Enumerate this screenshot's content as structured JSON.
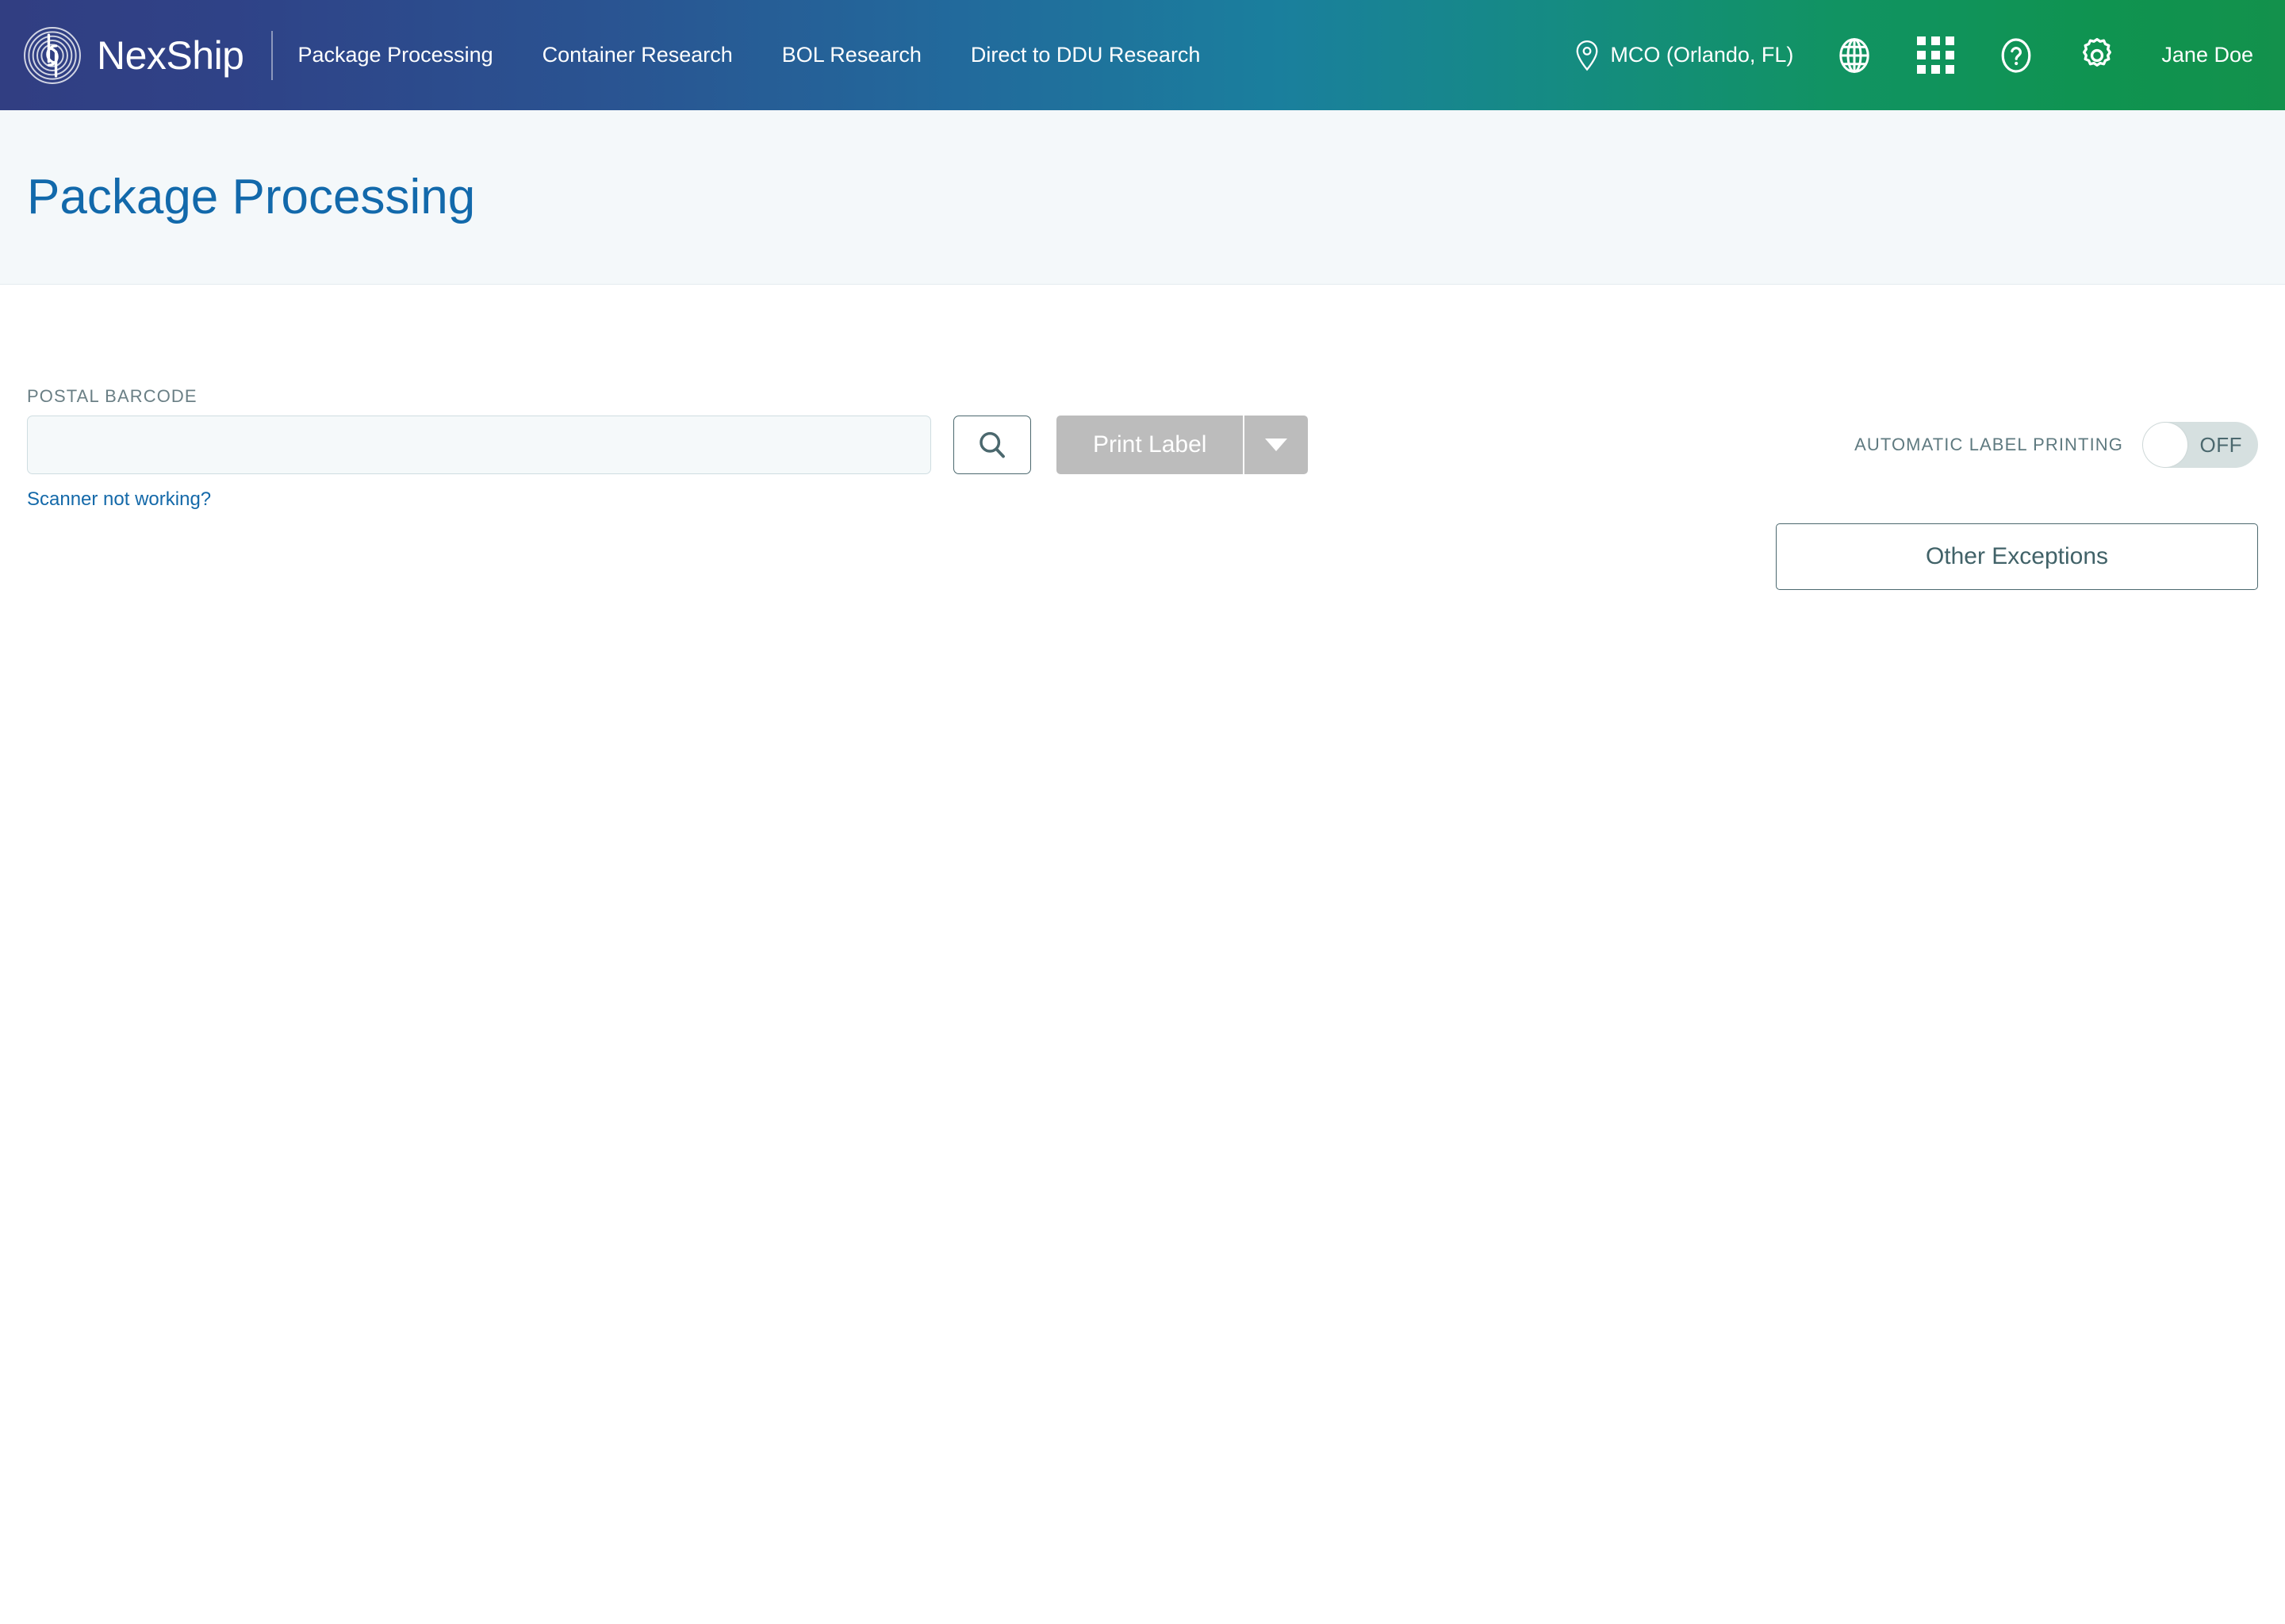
{
  "header": {
    "brand_name": "NexShip",
    "logo_icon": "nexship-fingerprint-logo",
    "nav": [
      {
        "label": "Package Processing",
        "icon": ""
      },
      {
        "label": "Container Research",
        "icon": ""
      },
      {
        "label": "BOL Research",
        "icon": ""
      },
      {
        "label": "Direct to DDU Research",
        "icon": ""
      }
    ],
    "location": {
      "icon": "location-pin-icon",
      "label": "MCO (Orlando, FL)"
    },
    "icons": [
      {
        "name": "globe-icon"
      },
      {
        "name": "apps-grid-icon"
      },
      {
        "name": "help-circle-icon"
      },
      {
        "name": "gear-icon"
      }
    ],
    "user_name": "Jane Doe",
    "gradient_start": "#313e82",
    "gradient_end": "#13914c"
  },
  "page": {
    "title": "Package Processing",
    "title_color": "#1269ab",
    "title_band_bg": "#f4f8fa"
  },
  "form": {
    "barcode_label": "POSTAL BARCODE",
    "barcode_value": "",
    "barcode_placeholder": "",
    "helper_link": "Scanner not working?",
    "helper_link_color": "#1469a9",
    "search_icon": "search-icon",
    "print_label": "Print Label",
    "print_dropdown_icon": "chevron-down-icon",
    "print_disabled": true,
    "print_disabled_color": "#bcbcbc"
  },
  "options": {
    "auto_print_label": "AUTOMATIC LABEL PRINTING",
    "auto_print_state": "OFF",
    "auto_print_on": false,
    "toggle_track_color": "#d6e0e0",
    "exceptions_label": "Other Exceptions",
    "accent_outline": "#4b686e"
  }
}
